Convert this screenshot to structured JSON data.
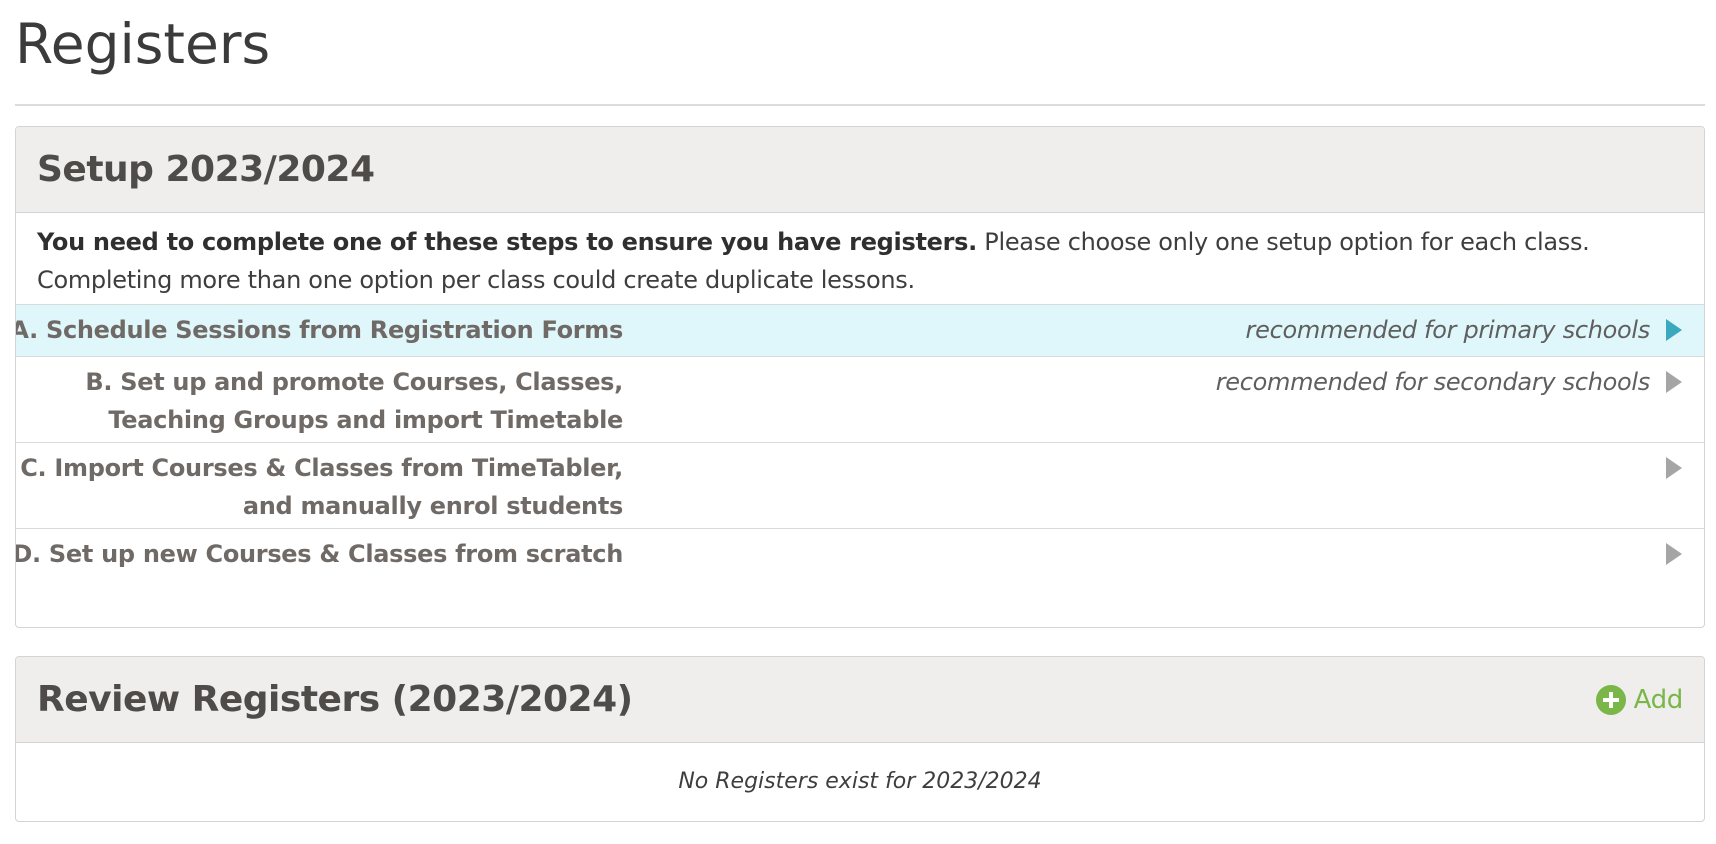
{
  "page": {
    "title": "Registers"
  },
  "setup": {
    "title": "Setup 2023/2024",
    "intro_strong": "You need to complete one of these steps to ensure you have registers.",
    "intro_text": " Please choose only one setup option for each class. Completing more than one option per class could create duplicate lessons.",
    "options": [
      {
        "label_lines": [
          "A. Schedule Sessions from Registration Forms"
        ],
        "note": "recommended for primary schools",
        "highlighted": true
      },
      {
        "label_lines": [
          "B. Set up and promote Courses, Classes,",
          "Teaching Groups and import Timetable"
        ],
        "note": "recommended for secondary schools",
        "highlighted": false
      },
      {
        "label_lines": [
          "C. Import Courses & Classes from TimeTabler,",
          "and manually enrol students"
        ],
        "note": "",
        "highlighted": false
      },
      {
        "label_lines": [
          "D. Set up new Courses & Classes from scratch"
        ],
        "note": "",
        "highlighted": false
      }
    ]
  },
  "review": {
    "title": "Review Registers (2023/2024)",
    "add_label": "Add",
    "add_icon": "plus-circle-icon",
    "empty_message": "No Registers exist for 2023/2024"
  },
  "colors": {
    "highlight_row": "#dff6fb",
    "highlight_arrow": "#3aa8bd",
    "add_green": "#7ab648",
    "panel_header": "#efeeed"
  }
}
